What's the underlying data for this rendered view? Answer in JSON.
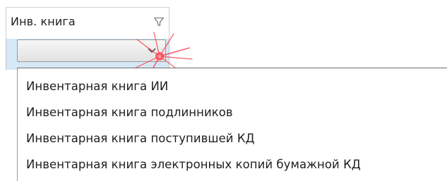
{
  "column_header": {
    "title": "Инв. книга",
    "filter_icon": "filter-icon"
  },
  "filter_combo": {
    "value": "",
    "arrow_icon": "chevron-down-icon"
  },
  "dropdown": {
    "items": [
      {
        "label": "Инвентарная книга ИИ"
      },
      {
        "label": "Инвентарная книга подлинников"
      },
      {
        "label": "Инвентарная книга поступившей КД"
      },
      {
        "label": "Инвентарная книга электронных копий бумажной КД"
      }
    ]
  },
  "colors": {
    "filter_band": "#d6e7f6",
    "cursor_highlight": "#ff3b4a"
  }
}
